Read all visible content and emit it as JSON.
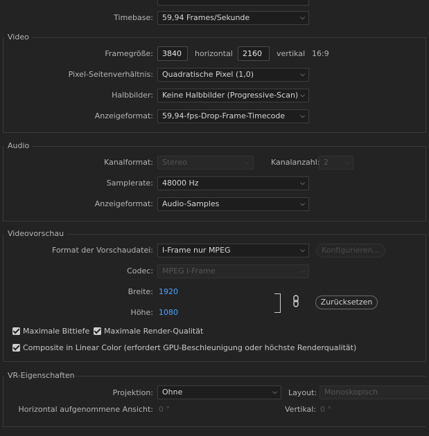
{
  "timebase": {
    "label": "Timebase:",
    "value": "59,94  Frames/Sekunde"
  },
  "video": {
    "section_title": "Video",
    "frame_size_label": "Framegröße:",
    "width": "3840",
    "horizontal_label": "horizontal",
    "height": "2160",
    "vertical_label": "vertikal",
    "aspect": "16:9",
    "pixel_aspect_label": "Pixel-Seitenverhältnis:",
    "pixel_aspect_value": "Quadratische Pixel (1,0)",
    "fields_label": "Halbbilder:",
    "fields_value": "Keine Halbbilder (Progressive-Scan)",
    "display_format_label": "Anzeigeformat:",
    "display_format_value": "59,94-fps-Drop-Frame-Timecode"
  },
  "audio": {
    "section_title": "Audio",
    "channel_format_label": "Kanalformat:",
    "channel_format_value": "Stereo",
    "channel_count_label": "Kanalanzahl:",
    "channel_count_value": "2",
    "sample_rate_label": "Samplerate:",
    "sample_rate_value": "48000 Hz",
    "display_format_label": "Anzeigeformat:",
    "display_format_value": "Audio-Samples"
  },
  "preview": {
    "section_title": "Videovorschau",
    "format_label": "Format der Vorschaudatei:",
    "format_value": "I-Frame nur MPEG",
    "configure_button": "Konfigurieren...",
    "codec_label": "Codec:",
    "codec_value": "MPEG I-Frame",
    "width_label": "Breite:",
    "width_value": "1920",
    "height_label": "Höhe:",
    "height_value": "1080",
    "reset_button": "Zurücksetzen",
    "max_bit_depth": "Maximale Bittiefe",
    "max_render_quality": "Maximale Render-Qualität",
    "composite_linear": "Composite in Linear Color (erfordert GPU-Beschleunigung oder höchste Renderqualität)"
  },
  "vr": {
    "section_title": "VR-Eigenschaften",
    "projection_label": "Projektion:",
    "projection_value": "Ohne",
    "layout_label": "Layout:",
    "layout_value": "Monoskopisch",
    "h_view_label": "Horizontal aufgenommene Ansicht:",
    "h_view_value": "0 °",
    "vertical_label": "Vertikal:",
    "vertical_value": "0 °"
  },
  "icons": {
    "chevron": "chevron-down-icon",
    "link": "link-icon",
    "checkbox": "check-icon"
  }
}
